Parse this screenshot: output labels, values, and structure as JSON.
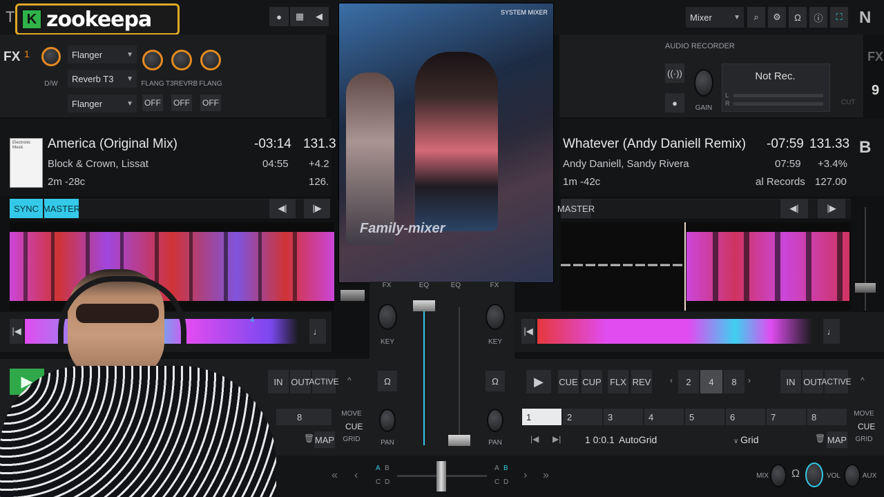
{
  "logo": {
    "text": "zookeepa",
    "badge": "K"
  },
  "topbar": {
    "mode_select": "Mixer",
    "app_letter": "N",
    "left_letter": "T"
  },
  "fx": {
    "label": "FX",
    "unit": "1",
    "dw_label": "D/W",
    "slots": [
      "Flanger",
      "Reverb T3",
      "Flanger"
    ],
    "knob_labels": [
      "FLANG",
      "T3REVRB",
      "FLANG"
    ],
    "toggles": [
      "OFF",
      "OFF",
      "OFF"
    ],
    "right_label": "FX"
  },
  "recorder": {
    "title": "AUDIO RECORDER",
    "status": "Not Rec.",
    "gain_label": "GAIN",
    "meter_l": "L",
    "meter_r": "R",
    "cut_label": "CUT"
  },
  "deck_a": {
    "title": "America (Original Mix)",
    "artist": "Block & Crown, Lissat",
    "key_info": "2m -28c",
    "remaining": "-03:14",
    "length": "04:55",
    "bpm": "131.3",
    "pitch": "+4.2",
    "orig_bpm": "126.",
    "sync_label": "SYNC",
    "master_label": "MASTER",
    "loop_in": "IN",
    "loop_out": "OUT",
    "loop_active": "ACTIVE",
    "hotcue_8": "8",
    "move_label": "MOVE",
    "cue_label": "CUE",
    "grid_label": "GRID",
    "map_label": "MAP",
    "beat_marker": "4"
  },
  "deck_b": {
    "letter": "B",
    "title": "Whatever (Andy Daniell Remix)",
    "artist": "Andy Daniell, Sandy Rivera",
    "key_info": "1m -42c",
    "label": "al Records",
    "remaining": "-07:59",
    "length": "07:59",
    "bpm": "131.33",
    "pitch": "+3.4%",
    "orig_bpm": "127.00",
    "master_label": "MASTER",
    "transport": [
      "CUE",
      "CUP",
      "FLX",
      "REV"
    ],
    "loop_sizes": [
      "2",
      "4",
      "8"
    ],
    "loop_in": "IN",
    "loop_out": "OUT",
    "loop_active": "ACTIVE",
    "hotcues": [
      "1",
      "2",
      "3",
      "4",
      "5",
      "6",
      "7",
      "8"
    ],
    "beat_pos": "1 0:0.1",
    "autogrid": "AutoGrid",
    "grid_select": "Grid",
    "map_label": "MAP",
    "move_label": "MOVE",
    "cue_label": "CUE",
    "grid_label": "GRID"
  },
  "mixer": {
    "key_label": "KEY",
    "pan_label": "PAN",
    "xfader_a": "A",
    "xfader_b": "B",
    "xfader_c": "C",
    "xfader_d": "D",
    "mix_label": "MIX",
    "vol_label": "VOL",
    "aux_label": "AUX",
    "fx_top": "FX",
    "eq_top": "EQ"
  },
  "video": {
    "watermark": "Family-mixer",
    "overlay_text": "SYSTEM MIXER"
  },
  "colors": {
    "accent_cyan": "#34c9e8",
    "knob_orange": "#e38a22",
    "wave_magenta": "#e04cf0",
    "wave_red": "#e5383b",
    "logo_gold": "#e0a826",
    "logo_green": "#2fb24a"
  }
}
